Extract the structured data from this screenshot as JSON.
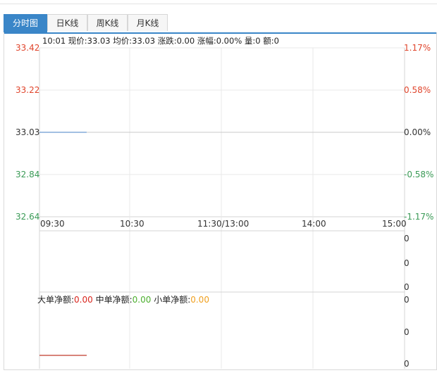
{
  "tabs": [
    {
      "label": "分时图",
      "active": true
    },
    {
      "label": "日K线",
      "active": false
    },
    {
      "label": "周K线",
      "active": false
    },
    {
      "label": "月K线",
      "active": false
    }
  ],
  "info_bar": "10:01 现价:33.03 均价:33.03 涨跌:0.00 涨幅:0.00% 量:0 额:0",
  "price_axis": [
    "33.42",
    "33.22",
    "33.03",
    "32.84",
    "32.64"
  ],
  "pct_axis": [
    "1.17%",
    "0.58%",
    "0.00%",
    "-0.58%",
    "-1.17%"
  ],
  "time_axis": [
    "09:30",
    "10:30",
    "11:30/13:00",
    "14:00",
    "15:00"
  ],
  "volume_axis": [
    "0",
    "0",
    "0"
  ],
  "fund_axis": [
    "0",
    "0",
    "0"
  ],
  "fund_flow": {
    "large_label": "大单净额:",
    "large_value": "0.00",
    "medium_label": "中单净额:",
    "medium_value": "0.00",
    "small_label": "小单净额:",
    "small_value": "0.00"
  },
  "chart_data": {
    "type": "line",
    "x": [
      "09:30",
      "10:01"
    ],
    "series": [
      {
        "values": [
          33.03,
          33.03
        ]
      }
    ],
    "ylim": [
      32.64,
      33.42
    ],
    "xlabel": "",
    "ylabel": ""
  },
  "colors": {
    "tab_active": "#3a86c8",
    "up": "#e0452c",
    "down": "#3a9a56",
    "price_line": "#6a9ad0",
    "fund_line": "#c0392b",
    "grid": "#e8e8e8"
  }
}
